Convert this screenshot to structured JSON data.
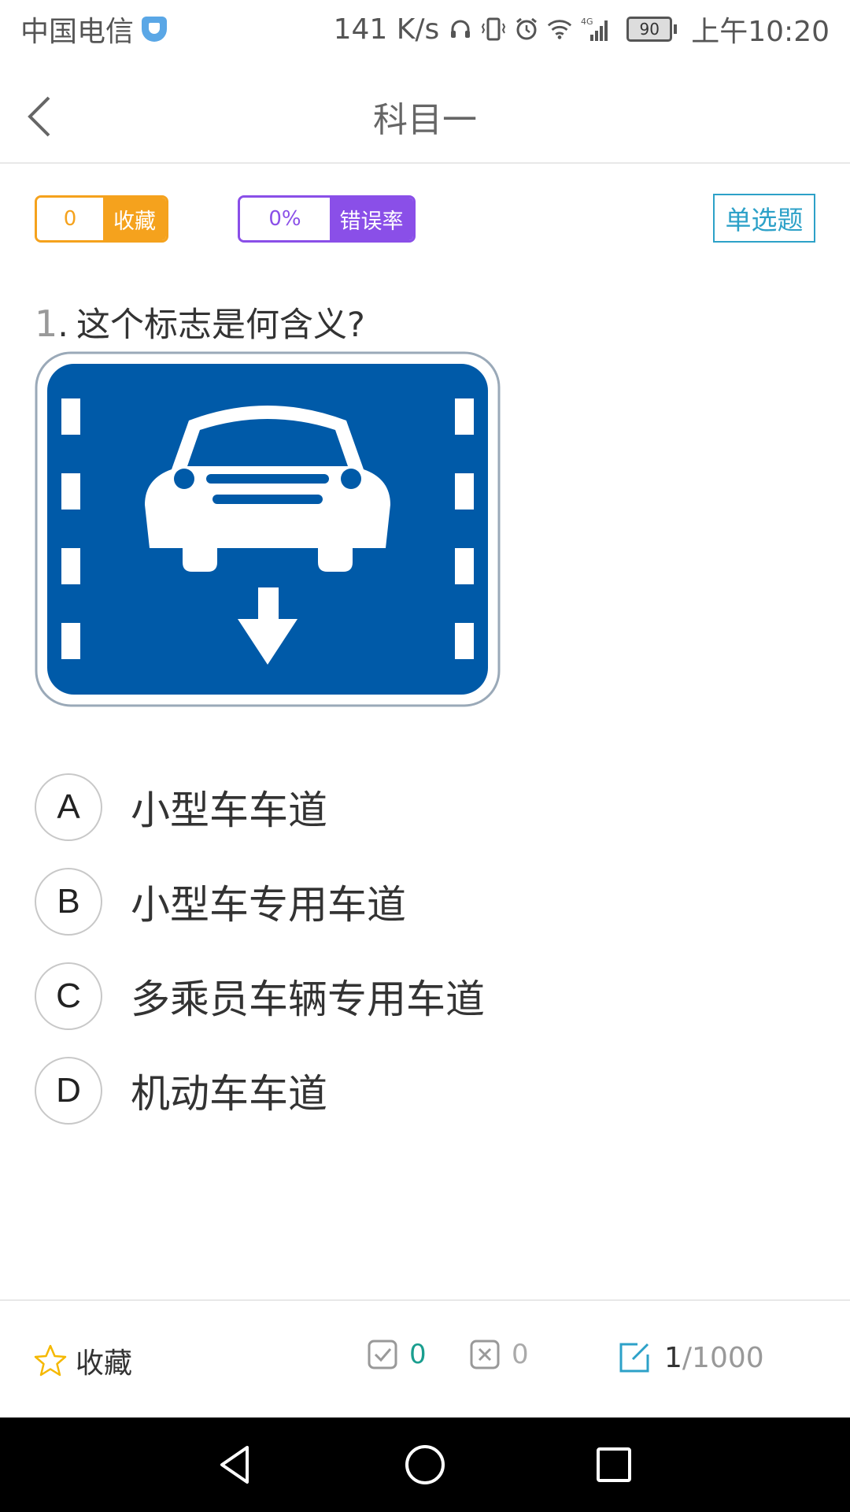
{
  "status_bar": {
    "carrier": "中国电信",
    "speed": "141 K/s",
    "network": "4G",
    "battery": "90",
    "time": "上午10:20"
  },
  "header": {
    "title": "科目一"
  },
  "stats": {
    "favorite_count": "0",
    "favorite_label": "收藏",
    "error_rate": "0%",
    "error_rate_label": "错误率",
    "question_type": "单选题"
  },
  "question": {
    "number": "1",
    "separator": ".",
    "text": "这个标志是何含义?"
  },
  "options": [
    {
      "letter": "A",
      "text": "小型车车道"
    },
    {
      "letter": "B",
      "text": "小型车专用车道"
    },
    {
      "letter": "C",
      "text": "多乘员车辆专用车道"
    },
    {
      "letter": "D",
      "text": "机动车车道"
    }
  ],
  "toolbar": {
    "favorite_label": "收藏",
    "correct_count": "0",
    "wrong_count": "0",
    "current": "1",
    "total": "/1000"
  },
  "colors": {
    "favorite_accent": "#f5a21d",
    "error_accent": "#8a4fe8",
    "type_accent": "#2da1c8",
    "correct_accent": "#1a9e8f",
    "star_outline": "#f5b800",
    "sign_blue": "#005aa8"
  },
  "icons": {
    "back": "chevron-left-icon",
    "star": "star-icon",
    "correct": "check-box-icon",
    "wrong": "x-box-icon",
    "progress": "edit-icon"
  }
}
